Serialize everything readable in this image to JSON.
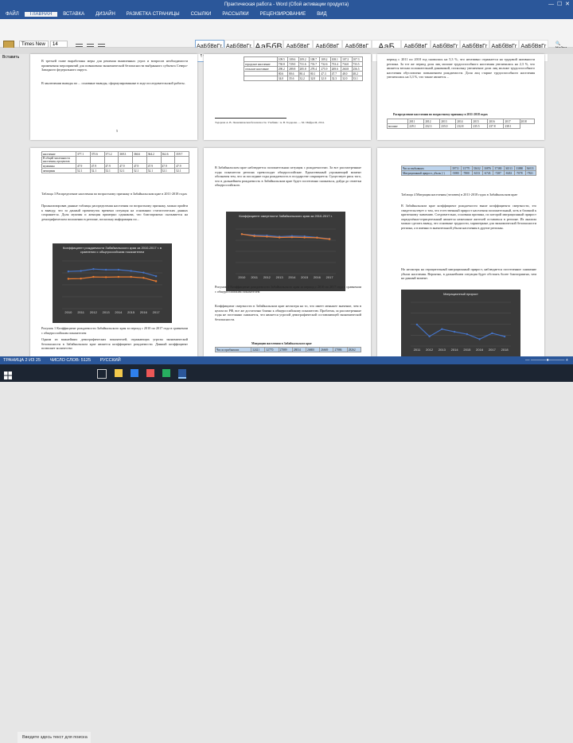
{
  "window": {
    "title": "Практическая работа - Word (Сбой активации продукта)"
  },
  "tabs": [
    "ФАЙЛ",
    "ГЛАВНАЯ",
    "ВСТАВКА",
    "ДИЗАЙН",
    "РАЗМЕТКА СТРАНИЦЫ",
    "ССЫЛКИ",
    "РАССЫЛКИ",
    "РЕЦЕНЗИРОВАНИЕ",
    "ВИД"
  ],
  "ribbon": {
    "paste_label": "Вставить",
    "font_name": "Times New Ro",
    "font_size": "14",
    "format": [
      "Ж",
      "К",
      "Ч"
    ],
    "find_label": "Найти"
  },
  "styles": [
    {
      "sample": "АаБбВвГг,",
      "name": "¶ Обычный"
    },
    {
      "sample": "АаБбВвГг,",
      "name": "Без интер..."
    },
    {
      "sample": "АаБбВ",
      "name": "Заголово..."
    },
    {
      "sample": "АаБбВвГ",
      "name": "Заголово..."
    },
    {
      "sample": "АаБбВвГ",
      "name": "Заголово..."
    },
    {
      "sample": "АаБбВвГ",
      "name": "Название"
    },
    {
      "sample": "АаБ",
      "name": "Название"
    },
    {
      "sample": "АаБбВвГ",
      "name": "Подзагол..."
    },
    {
      "sample": "АаБбВвГг",
      "name": "Слабое в..."
    },
    {
      "sample": "АаБбВвГг",
      "name": "Выделение"
    },
    {
      "sample": "АаБбВвГг",
      "name": "Сильное..."
    },
    {
      "sample": "АаБбВвГг",
      "name": "Строгий"
    }
  ],
  "pages": {
    "p1": {
      "text1": "В третьей главе выработаны меры для решения выявленных угроз и вопросов необходимости применения мероприятий для повышения экономической безопасности выбранного субъекта Северо-Западного федерального округа.",
      "text2": "В заключении выводы по ... основные выводы, сформулированные в ходе исследовательской работы.",
      "page_num": "5"
    },
    "p2": {
      "table": [
        [
          "",
          "109.5",
          "109.6",
          "109.2",
          "108.7",
          "109.2",
          "108.1",
          "107.2",
          "107.3"
        ],
        [
          "городское население",
          "730.8",
          "729.0",
          "731.6",
          "733.7",
          "732.6",
          "733.4",
          "734.0",
          "733.5"
        ],
        [
          "сельское население",
          "290.2",
          "289.8",
          "285.8",
          "278.4",
          "275.9",
          "269.6",
          "260.8",
          "256.5"
        ],
        [
          "",
          "80.6",
          "80.6",
          "80.4",
          "80.1",
          "47.3",
          "47.7",
          "48.0",
          "48.2"
        ],
        [
          "",
          "34.0",
          "35.6",
          "32.2",
          "32.0",
          "32.0",
          "32.3",
          "32.0",
          "33.1"
        ]
      ],
      "footnote": "Тодорова А. В. Экономическая безопасность: Учебник / А. В. Тодорова. — М.: Инфра-М, 2014."
    },
    "p3": {
      "text": "период с 2011 по 2018 год снизилась на 5,3 %, что негативно отражается на трудовой активности региона. За тот же период доля лиц моложе трудоспособного населения увеличилась на 2,3 %, что является весьма положительной динамикой, поскольку увеличение доли лиц моложе трудоспособного населения обусловлено повышением рождаемости. Доля лиц старше трудоспособного населения увеличилась на 3,3 %, что также является ... ",
      "caption": "Распределение населения по возрастному признаку в 2011-2018 годах",
      "years": [
        "2011",
        "2012",
        "2013",
        "2014",
        "2015",
        "2016",
        "2017",
        "2018"
      ],
      "row_label": "моложе",
      "row": [
        "229.1",
        "232.3",
        "235.0",
        "232.8",
        "235.5",
        "237.8",
        "238.1"
      ]
    },
    "p4": {
      "caption": "Таблица 3 Распределение населения по возрастному признаку в Забайкальском крае в 2011-2018 годах",
      "text": "Проанализировав данные таблицы распределения населения по возрастному признаку, можно прийти к выводу, что за данный промежуток времени ситуация на основании статистических данных сохраняется. Доля мужчин и женщин примерно одинакова, что благоприятно сказывается на демографическом положении в регионе, поскольку информация по...",
      "chart_title": "Коэффициент рождаемости Забайкальского края за 2010-2017 г. в сравнении с общероссийским показателем",
      "chart_caption": "Рисунок 1 Коэффициент рождаемости Забайкальского края за период с 2010 по 2017 года в сравнении с общероссийским показателем",
      "text2": "Одним из важнейших демографических показателей, отражающих угрозы экономической безопасности в Забайкальском крае является коэффициент рождаемости. Данный коэффициент позволяет количество"
    },
    "p5": {
      "text1": "В Забайкальском крае наблюдается положительная ситуация с рождаемостью. За все рассмотренные годы показатели региона превосходят общероссийские. Единственный угрожающий момент обозначен тем, что за последние годы рождаемость в государстве сокращается. Существует риск того, что в дальнейшем рождаемость в Забайкальском крае будет постепенно снижаться, дойдя до отметки общероссийского.",
      "chart_title": "Коэффициент смертности Забайкальского края за 2010-2017 г.",
      "chart_caption": "Рисунок 2 Коэффициент рождаемости Забайкальского края за период с 2010 по 2017 года в сравнении с общероссийским показателем",
      "text2": "Коэффициент смертности в Забайкальском крае несмотря на то, что имеет меньшее значение, чем в целом по РФ, все же достаточно близко к общероссийскому показателю. Проблема, за рассмотренные годы не постоянно снижается, что является угрозой демографической составляющей экономической безопасности.",
      "table_caption": "Миграция населения в Забайкальском крае",
      "table_row": [
        "Число прибывших",
        "32421",
        "32770",
        "27889",
        "28034",
        "26800",
        "26669",
        "27886",
        "28262"
      ]
    },
    "p6": {
      "table": [
        [
          "Число выбывших",
          "39711",
          "33770",
          "33632",
          "30876",
          "37380",
          "36513",
          "33880",
          "36033"
        ],
        [
          "Миграционный прирост, убыль (-)",
          "-5080",
          "-7800",
          "-6133",
          "-6743",
          "-7287",
          "-8433",
          "-7078",
          "-7821"
        ]
      ],
      "caption": "Таблица 4 Миграция населения (человек) в 2011-2018 годах в Забайкальском крае",
      "text1": "В Забайкальском крае коэффициент рождаемости выше коэффициента смертности, это свидетельствует о том, что естественный прирост населения положительный, хоть и близкий к критичному значению. Следовательно, основная причина, по которой миграционный прирост определённо-отрицательный является нежелание жителей оставаться в регионе. Из анализа можно сделать вывод, что основные трудности, характерные для экономической безопасности региона, а в именно в значительной убыли населения в другие регионы.",
      "text2": "Но несмотря на отрицательный миграционный прирост, наблюдается постепенное снижение убыли населения. Вероятно, в дальнейшем ситуация будет обстоять более благоприятно, чем на данный момент.",
      "chart_title": "Миграционный прирост"
    }
  },
  "chart_data": [
    {
      "type": "line",
      "categories": [
        "2010",
        "2011",
        "2012",
        "2013",
        "2014",
        "2015",
        "2016",
        "2017"
      ],
      "series": [
        {
          "values": [
            15.6,
            15.8,
            16.6,
            16.3,
            16.3,
            15.8,
            15.1,
            13.6
          ]
        },
        {
          "values": [
            12.5,
            12.6,
            13.3,
            13.2,
            13.3,
            13.3,
            12.9,
            11.5
          ]
        }
      ],
      "ylim": [
        0,
        20
      ]
    },
    {
      "type": "line",
      "categories": [
        "2010",
        "2011",
        "2012",
        "2013",
        "2014",
        "2015",
        "2016",
        "2017"
      ],
      "series": [
        {
          "values": [
            14.2,
            13.8,
            13.7,
            13.3,
            13.5,
            13.4,
            13.0,
            12.5
          ]
        },
        {
          "values": [
            14.2,
            13.5,
            13.3,
            13.0,
            13.1,
            13.0,
            12.9,
            12.4
          ]
        }
      ],
      "ylim": [
        0,
        16
      ]
    },
    {
      "type": "line",
      "categories": [
        "2011",
        "2012",
        "2013",
        "2014",
        "2015",
        "2016",
        "2017",
        "2018"
      ],
      "series": [
        {
          "values": [
            -5080,
            -7800,
            -6133,
            -6743,
            -7287,
            -8433,
            -7078,
            -7821
          ]
        }
      ],
      "ylim": [
        -10000,
        0
      ]
    }
  ],
  "status": {
    "page_info": "ТРАНИЦА 2 ИЗ 25",
    "words": "ЧИСЛО СЛОВ: 5125",
    "lang": "РУССКИЙ"
  },
  "taskbar": {
    "search_placeholder": "Введите здесь текст для поиска"
  },
  "colors": {
    "word_blue": "#2b579a",
    "chart_bg": "#3a3a3a",
    "line_a": "#4472c4",
    "line_b": "#ed7d31"
  }
}
